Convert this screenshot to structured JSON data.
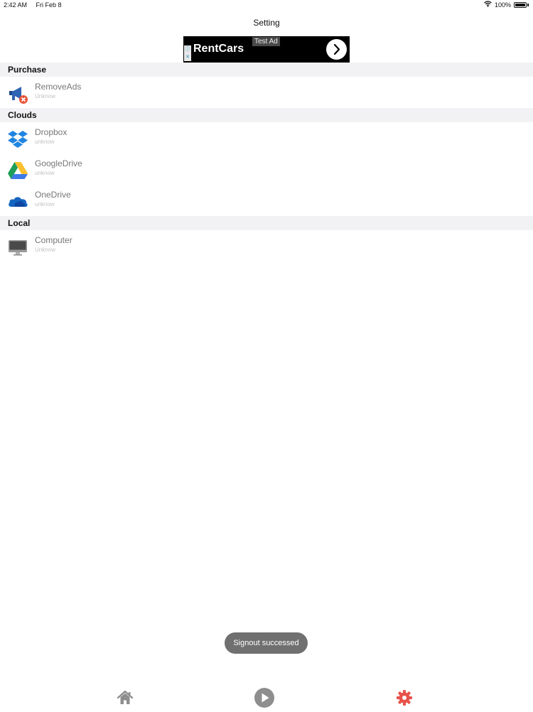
{
  "status_bar": {
    "time": "2:42 AM",
    "date": "Fri Feb 8",
    "battery": "100%"
  },
  "nav": {
    "title": "Setting"
  },
  "ad": {
    "label": "Test Ad",
    "title": "RentCars"
  },
  "sections": {
    "purchase": {
      "title": "Purchase",
      "items": [
        {
          "name": "RemoveAds",
          "sub": "Unknow",
          "icon": "megaphone-remove-icon"
        }
      ]
    },
    "clouds": {
      "title": "Clouds",
      "items": [
        {
          "name": "Dropbox",
          "sub": "unknow",
          "icon": "dropbox-icon"
        },
        {
          "name": "GoogleDrive",
          "sub": "unknow",
          "icon": "google-drive-icon"
        },
        {
          "name": "OneDrive",
          "sub": "unknow",
          "icon": "onedrive-icon"
        }
      ]
    },
    "local": {
      "title": "Local",
      "items": [
        {
          "name": "Computer",
          "sub": "Unknow",
          "icon": "computer-icon"
        }
      ]
    }
  },
  "toast": {
    "message": "Signout successed"
  },
  "tabs": [
    {
      "name": "home",
      "icon": "home-icon"
    },
    {
      "name": "play",
      "icon": "play-icon"
    },
    {
      "name": "settings",
      "icon": "gear-icon",
      "active_color": "#e8524a"
    }
  ]
}
